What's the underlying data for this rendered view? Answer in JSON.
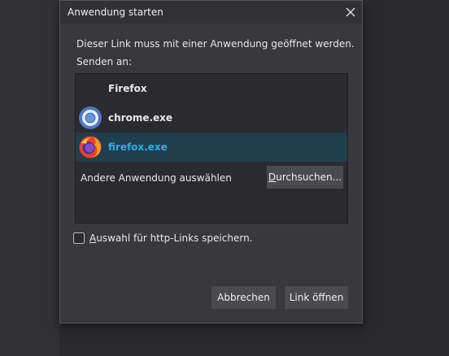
{
  "dialog": {
    "title": "Anwendung starten",
    "message": "Dieser Link muss mit einer Anwendung geöffnet werden.",
    "send_to_label": "Senden an:",
    "list_header": "Firefox",
    "apps": [
      {
        "label": "chrome.exe",
        "icon": "chrome-icon"
      },
      {
        "label": "firefox.exe",
        "icon": "firefox-icon",
        "selected": true
      }
    ],
    "other_app_label": "Andere Anwendung auswählen",
    "browse_button": {
      "access_key": "D",
      "rest": "urchsuchen..."
    },
    "remember_checkbox": {
      "access_key": "A",
      "rest": "uswahl für http-Links speichern.",
      "checked": false
    },
    "cancel_button": "Abbrechen",
    "open_button": "Link öffnen"
  },
  "colors": {
    "background": "#2a2a2e",
    "dialog": "#38383d",
    "selection": "#1f3f4d",
    "selected_text": "#2ab0ea",
    "button": "#4a4a4f"
  }
}
